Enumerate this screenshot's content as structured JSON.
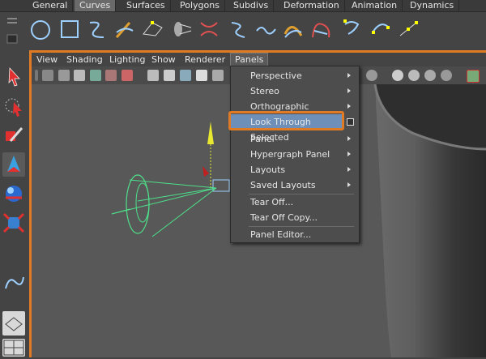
{
  "shelf_tabs": [
    {
      "label": "General",
      "active": false
    },
    {
      "label": "Curves",
      "active": true
    },
    {
      "label": "Surfaces",
      "active": false
    },
    {
      "label": "Polygons",
      "active": false
    },
    {
      "label": "Subdivs",
      "active": false
    },
    {
      "label": "Deformation",
      "active": false
    },
    {
      "label": "Animation",
      "active": false
    },
    {
      "label": "Dynamics",
      "active": false
    }
  ],
  "shelf_icons": [
    "nurbs-circle-icon",
    "nurbs-square-icon",
    "cv-curve-icon",
    "ep-curve-icon",
    "pencil-curve-icon",
    "arc-icon",
    "revolve-icon",
    "loft-icon",
    "planar-icon",
    "extrude-icon",
    "birail-icon",
    "boundary-icon",
    "square-surface-icon",
    "bevel-icon",
    "attach-curves-icon"
  ],
  "panel_menus": [
    "View",
    "Shading",
    "Lighting",
    "Show",
    "Renderer",
    "Panels"
  ],
  "panels_menu": {
    "items": [
      {
        "label": "Perspective",
        "submenu": true
      },
      {
        "label": "Stereo",
        "submenu": true
      },
      {
        "label": "Orthographic",
        "submenu": true
      },
      {
        "label": "Look Through Selected",
        "submenu": false,
        "highlighted": true,
        "option_box": true
      },
      {
        "label": "Panel",
        "submenu": true
      },
      {
        "label": "Hypergraph Panel",
        "submenu": true
      },
      {
        "label": "Layouts",
        "submenu": true
      },
      {
        "label": "Saved Layouts",
        "submenu": true
      },
      {
        "label": "Tear Off...",
        "submenu": false
      },
      {
        "label": "Tear Off Copy...",
        "submenu": false
      },
      {
        "label": "Panel Editor...",
        "submenu": false
      }
    ]
  },
  "colors": {
    "accent": "#e07a25",
    "highlight": "#6e8fb8",
    "viewport": "#585858",
    "camera": "#4ee08a"
  }
}
